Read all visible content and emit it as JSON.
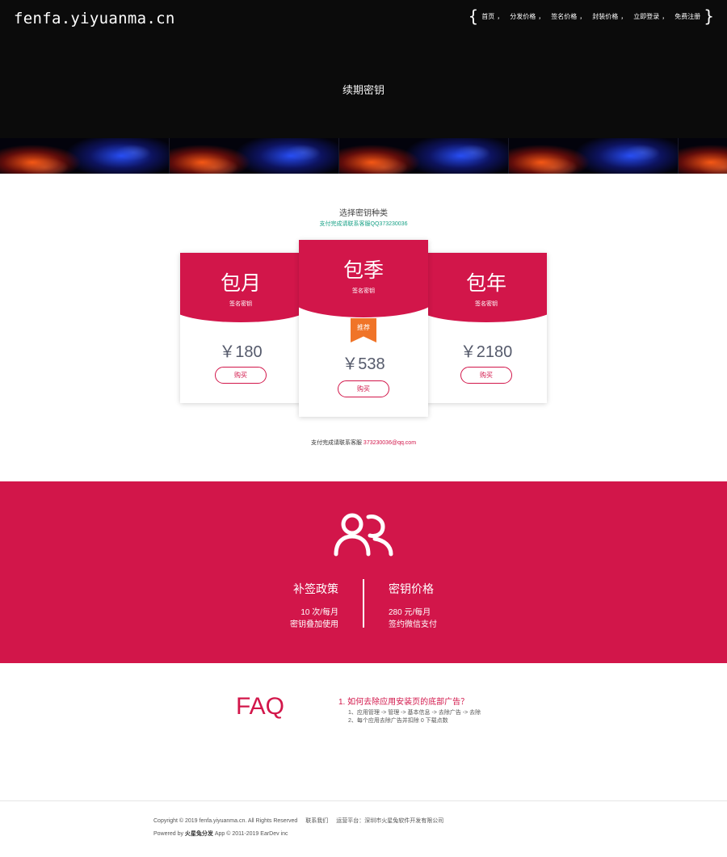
{
  "header": {
    "logo": "fenfa.yiyuanma.cn",
    "nav": [
      {
        "label": "首页",
        "sep": "，"
      },
      {
        "label": "分发价格",
        "sep": "，"
      },
      {
        "label": "签名价格",
        "sep": "，"
      },
      {
        "label": "封装价格",
        "sep": "，"
      },
      {
        "label": "立即登录",
        "sep": "，"
      },
      {
        "label": "免费注册",
        "sep": ""
      }
    ],
    "brace_open": "{",
    "brace_close": "}",
    "hero_title": "续期密钥"
  },
  "pricing": {
    "title": "选择密钥种类",
    "subtitle": "支付完成请联系客服QQ373230036",
    "plans": [
      {
        "name": "包月",
        "desc": "签名密钥",
        "price": "￥180",
        "buy": "购买"
      },
      {
        "name": "包季",
        "desc": "签名密钥",
        "price": "￥538",
        "buy": "购买",
        "badge": "推荐"
      },
      {
        "name": "包年",
        "desc": "签名密钥",
        "price": "￥2180",
        "buy": "购买"
      }
    ],
    "contact_text": "支付完成请联系客服 ",
    "contact_email": "373230036@qq.com"
  },
  "policy": {
    "left": {
      "title": "补签政策",
      "line1": "10 次/每月",
      "line2": "密钥叠加使用"
    },
    "right": {
      "title": "密钥价格",
      "line1": "280 元/每月",
      "line2": "签约微信支付"
    },
    "icon": "users-icon"
  },
  "faq": {
    "title": "FAQ",
    "question": "1. 如何去除应用安装页的底部广告？",
    "answers": [
      "1、应用管理 -> 管理 -> 基本信息 -> 去除广告 -> 去除",
      "2、每个应用去除广告并扣除 0 下载点数"
    ]
  },
  "footer": {
    "copyright": "Copyright © 2019 fenfa.yiyuanma.cn. All Rights Reserved",
    "contact": "联系我们",
    "operator": "运营平台：深圳市火星兔软件开发有限公司",
    "powered_prefix": "Powered by ",
    "powered_brand": "火星兔分发",
    "powered_suffix": " App © 2011-2019 EarDev inc"
  },
  "colors": {
    "brand_red": "#d2164a",
    "header_bg": "#0b0b0b",
    "badge_orange": "#f07428",
    "subtitle_teal": "#16a085"
  }
}
